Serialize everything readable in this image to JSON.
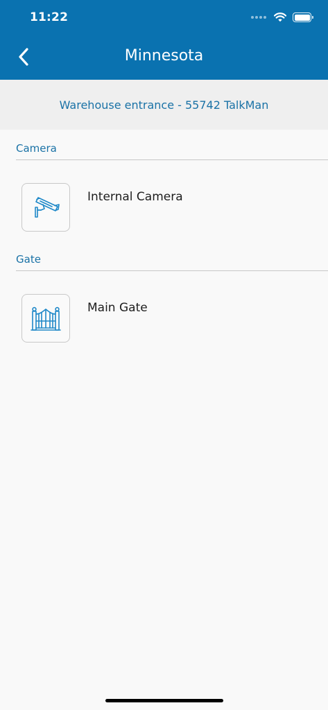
{
  "status_bar": {
    "time": "11:22"
  },
  "header": {
    "title": "Minnesota"
  },
  "subheader": {
    "text": "Warehouse entrance - 55742 TalkMan"
  },
  "sections": [
    {
      "label": "Camera",
      "items": [
        {
          "name": "Internal Camera",
          "icon": "security-camera-icon"
        }
      ]
    },
    {
      "label": "Gate",
      "items": [
        {
          "name": "Main Gate",
          "icon": "gate-icon"
        }
      ]
    }
  ],
  "colors": {
    "brand": "#0a72b0",
    "accent_text": "#1a72a6",
    "icon": "#1e88c8"
  }
}
